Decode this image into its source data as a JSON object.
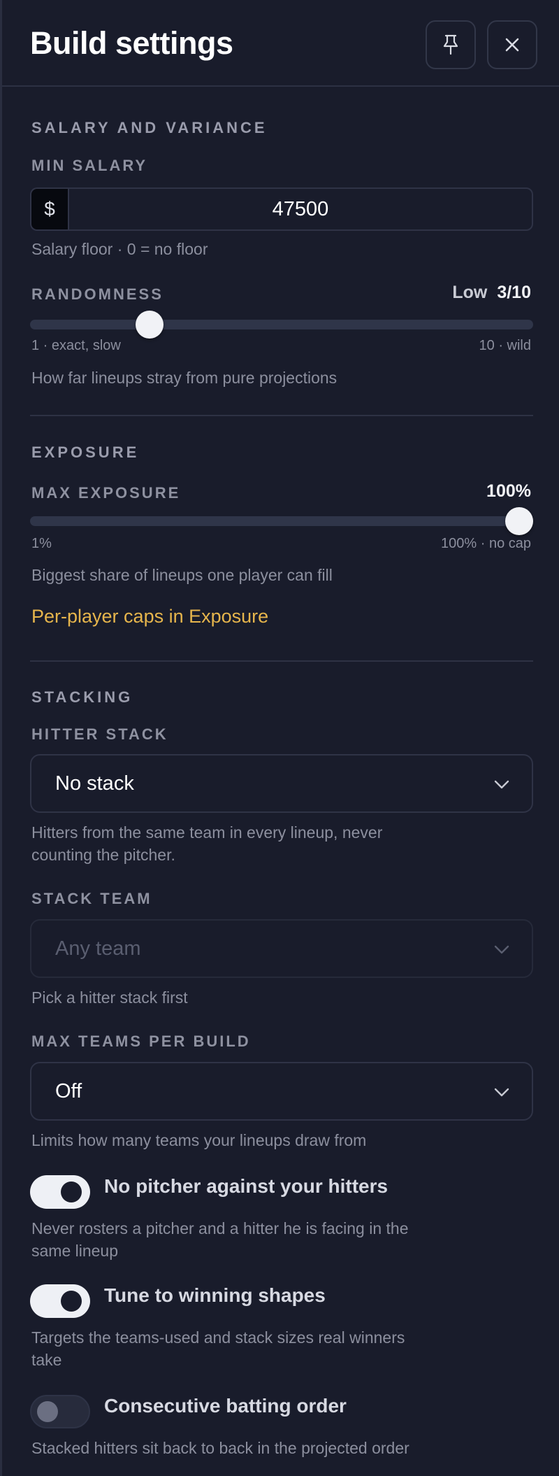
{
  "header": {
    "title": "Build settings",
    "pin_icon": "pin-icon",
    "close_icon": "close-icon"
  },
  "salary": {
    "section_title": "SALARY AND VARIANCE",
    "min_salary_label": "MIN SALARY",
    "currency_symbol": "$",
    "min_salary_value": "47500",
    "min_salary_help": "Salary floor · 0 = no floor",
    "randomness_label": "RANDOMNESS",
    "randomness_level": "Low",
    "randomness_value": "3/10",
    "randomness_fraction": 0.222,
    "randomness_min": "1 · exact, slow",
    "randomness_max": "10 · wild",
    "randomness_help": "How far lineups stray from pure projections"
  },
  "exposure": {
    "section_title": "EXPOSURE",
    "max_exposure_label": "MAX EXPOSURE",
    "max_exposure_value": "100%",
    "max_exposure_fraction": 1.0,
    "range_min": "1%",
    "range_max": "100% · no cap",
    "help": "Biggest share of lineups one player can fill",
    "link": "Per-player caps in Exposure"
  },
  "stacking": {
    "section_title": "STACKING",
    "hitter_stack_label": "HITTER STACK",
    "hitter_stack_value": "No stack",
    "hitter_stack_help_1": "Hitters from the same team in every lineup, never",
    "hitter_stack_help_2": "counting the pitcher.",
    "stack_team_label": "STACK TEAM",
    "stack_team_placeholder": "Any team",
    "stack_team_help": "Pick a hitter stack first",
    "max_teams_label": "MAX TEAMS PER BUILD",
    "max_teams_value": "Off",
    "max_teams_help": "Limits how many teams your lineups draw from",
    "toggles": [
      {
        "label": "No pitcher against your hitters",
        "on": true,
        "help_1": "Never rosters a pitcher and a hitter he is facing in the",
        "help_2": "same lineup"
      },
      {
        "label": "Tune to winning shapes",
        "on": true,
        "help_1": "Targets the teams-used and stack sizes real winners",
        "help_2": "take"
      },
      {
        "label": "Consecutive batting order",
        "on": false,
        "help_1": "Stacked hitters sit back to back in the projected order"
      }
    ]
  },
  "colors": {
    "background": "#191c2b",
    "accent_link": "#e6b54c",
    "track": "#2f3549",
    "thumb": "#f1f2f6"
  }
}
